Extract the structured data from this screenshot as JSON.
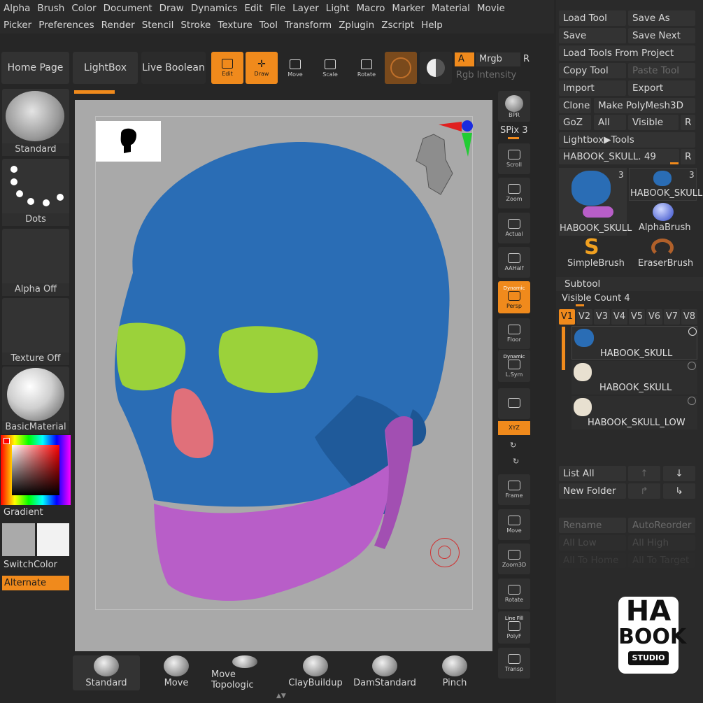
{
  "menu": {
    "row1": [
      "Alpha",
      "Brush",
      "Color",
      "Document",
      "Draw",
      "Dynamics",
      "Edit",
      "File",
      "Layer",
      "Light",
      "Macro",
      "Marker",
      "Material",
      "Movie"
    ],
    "row2": [
      "Picker",
      "Preferences",
      "Render",
      "Stencil",
      "Stroke",
      "Texture",
      "Tool",
      "Transform",
      "Zplugin",
      "Zscript",
      "Help"
    ]
  },
  "shelf": {
    "home": "Home Page",
    "lightbox": "LightBox",
    "live_boolean": "Live Boolean",
    "edit": "Edit",
    "draw": "Draw",
    "move": "Move",
    "scale": "Scale",
    "rotate": "Rotate",
    "a": "A",
    "mrgb": "Mrgb",
    "r": "R",
    "rgb_intensity": "Rgb Intensity"
  },
  "left": {
    "standard": "Standard",
    "dots": "Dots",
    "alpha_off": "Alpha Off",
    "texture_off": "Texture Off",
    "material": "BasicMaterial",
    "gradient": "Gradient",
    "switchcolor": "SwitchColor",
    "alternate": "Alternate"
  },
  "vtools": {
    "bpr": "BPR",
    "spix": "SPix 3",
    "scroll": "Scroll",
    "zoom": "Zoom",
    "actual": "Actual",
    "aahalf": "AAHalf",
    "dynamic1": "Dynamic",
    "persp": "Persp",
    "floor": "Floor",
    "dynamic2": "Dynamic",
    "lsym": "L.Sym",
    "xyz": "XYZ",
    "frame": "Frame",
    "move": "Move",
    "zoom3d": "Zoom3D",
    "rotate": "Rotate",
    "linefill": "Line Fill",
    "polyf": "PolyF",
    "transp": "Transp"
  },
  "brushes": [
    "Standard",
    "Move",
    "Move Topologic",
    "ClayBuildup",
    "DamStandard",
    "Pinch"
  ],
  "tool": {
    "load": "Load Tool",
    "save_as": "Save As",
    "save": "Save",
    "save_next": "Save Next",
    "load_from_project": "Load Tools From Project",
    "copy": "Copy Tool",
    "paste": "Paste Tool",
    "import": "Import",
    "export": "Export",
    "clone": "Clone",
    "make_polymesh": "Make PolyMesh3D",
    "goz": "GoZ",
    "all": "All",
    "visible": "Visible",
    "r": "R",
    "lightbox_tools": "Lightbox▶Tools",
    "current": "HABOOK_SKULL. 49",
    "thumb1": "HABOOK_SKULL",
    "thumb1_count": "3",
    "thumb2": "HABOOK_SKULL",
    "thumb2_count": "3",
    "alphabrush": "AlphaBrush",
    "simplebrush": "SimpleBrush",
    "eraserbrush": "EraserBrush"
  },
  "subtool": {
    "title": "Subtool",
    "visible_count": "Visible Count 4",
    "tabs": [
      "V1",
      "V2",
      "V3",
      "V4",
      "V5",
      "V6",
      "V7",
      "V8"
    ],
    "items": [
      "HABOOK_SKULL",
      "HABOOK_SKULL",
      "HABOOK_SKULL_LOW"
    ],
    "list_all": "List All",
    "new_folder": "New Folder",
    "rename": "Rename",
    "autoreorder": "AutoReorder",
    "all_low": "All Low",
    "all_high": "All High",
    "all_to_home": "All To Home",
    "all_to_target": "All To Target"
  },
  "logo": {
    "line1": "HA",
    "line2": "BOOK",
    "line3": "STUDIO"
  },
  "colors": {
    "accent": "#f08a1c",
    "skull": "#2a6db5",
    "jaw": "#b85ec8",
    "eyes": "#9bd23a",
    "nose": "#e0707a",
    "canvas": "#a9a9a9"
  }
}
